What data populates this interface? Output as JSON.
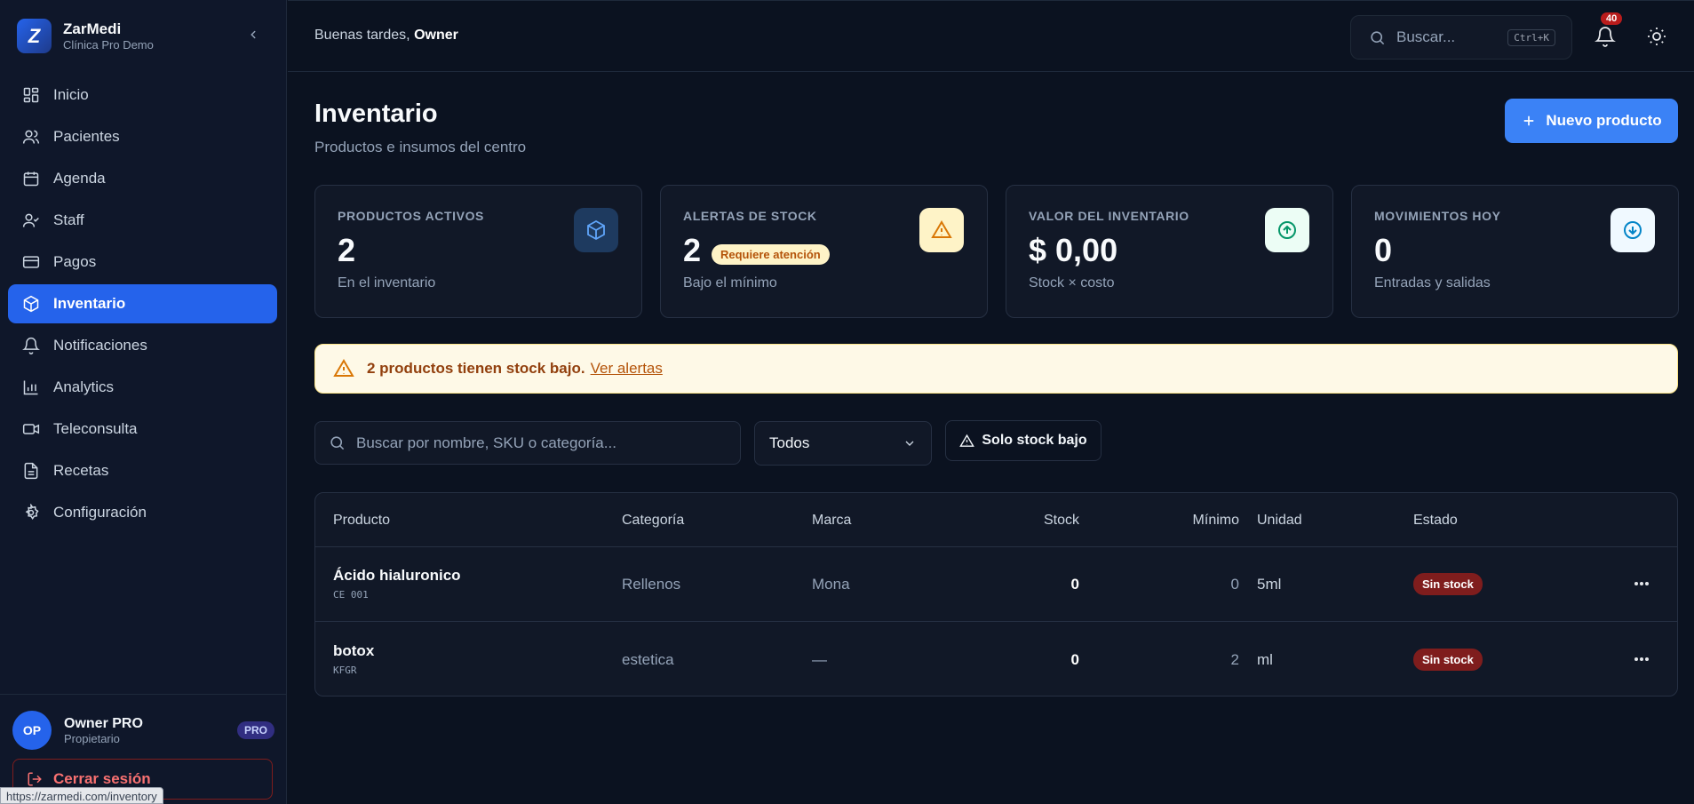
{
  "brand": {
    "logo_letter": "Z",
    "name": "ZarMedi",
    "subtitle": "Clínica Pro Demo"
  },
  "sidebar": {
    "items": [
      {
        "label": "Inicio",
        "icon": "grid-icon",
        "active": false
      },
      {
        "label": "Pacientes",
        "icon": "users-icon",
        "active": false
      },
      {
        "label": "Agenda",
        "icon": "calendar-icon",
        "active": false
      },
      {
        "label": "Staff",
        "icon": "user-check-icon",
        "active": false
      },
      {
        "label": "Pagos",
        "icon": "credit-card-icon",
        "active": false
      },
      {
        "label": "Inventario",
        "icon": "package-icon",
        "active": true
      },
      {
        "label": "Notificaciones",
        "icon": "bell-icon",
        "active": false
      },
      {
        "label": "Analytics",
        "icon": "bar-chart-icon",
        "active": false
      },
      {
        "label": "Teleconsulta",
        "icon": "video-icon",
        "active": false
      },
      {
        "label": "Recetas",
        "icon": "file-text-icon",
        "active": false
      },
      {
        "label": "Configuración",
        "icon": "settings-icon",
        "active": false
      }
    ],
    "user": {
      "initials": "OP",
      "name": "Owner PRO",
      "role": "Propietario",
      "plan": "PRO"
    },
    "logout_label": "Cerrar sesión"
  },
  "status_url": "https://zarmedi.com/inventory",
  "topbar": {
    "greeting_prefix": "Buenas tardes,",
    "greeting_name": "Owner",
    "search_placeholder": "Buscar...",
    "search_shortcut": "Ctrl+K",
    "notification_count": "40"
  },
  "page": {
    "title": "Inventario",
    "subtitle": "Productos e insumos del centro",
    "new_button": "Nuevo producto"
  },
  "stats": [
    {
      "label": "PRODUCTOS ACTIVOS",
      "value": "2",
      "desc": "En el inventario",
      "icon": "package-icon",
      "accent": "#3b82f6"
    },
    {
      "label": "ALERTAS DE STOCK",
      "value": "2",
      "badge": "Requiere atención",
      "desc": "Bajo el mínimo",
      "icon": "warning-icon",
      "accent": "#d97706"
    },
    {
      "label": "VALOR DEL INVENTARIO",
      "value": "$ 0,00",
      "desc": "Stock × costo",
      "icon": "arrow-up-circle-icon",
      "accent": "#059669"
    },
    {
      "label": "MOVIMIENTOS HOY",
      "value": "0",
      "desc": "Entradas y salidas",
      "icon": "arrow-down-circle-icon",
      "accent": "#0284c7"
    }
  ],
  "alert": {
    "message": "2 productos tienen stock bajo.",
    "link": "Ver alertas"
  },
  "filters": {
    "search_placeholder": "Buscar por nombre, SKU o categoría...",
    "category_selected": "Todos",
    "low_stock_label": "Solo stock bajo"
  },
  "table": {
    "columns": [
      "Producto",
      "Categoría",
      "Marca",
      "Stock",
      "Mínimo",
      "Unidad",
      "Estado"
    ],
    "rows": [
      {
        "name": "Ácido hialuronico",
        "sku": "CE 001",
        "category": "Rellenos",
        "brand": "Mona",
        "stock": "0",
        "minimum": "0",
        "unit": "5ml",
        "status": "Sin stock"
      },
      {
        "name": "botox",
        "sku": "KFGR",
        "category": "estetica",
        "brand": "—",
        "stock": "0",
        "minimum": "2",
        "unit": "ml",
        "status": "Sin stock"
      }
    ]
  },
  "colors": {
    "primary": "#2563eb",
    "danger": "#7f1d1d",
    "warning_bg": "#fef9e7",
    "background": "#0b1220"
  }
}
